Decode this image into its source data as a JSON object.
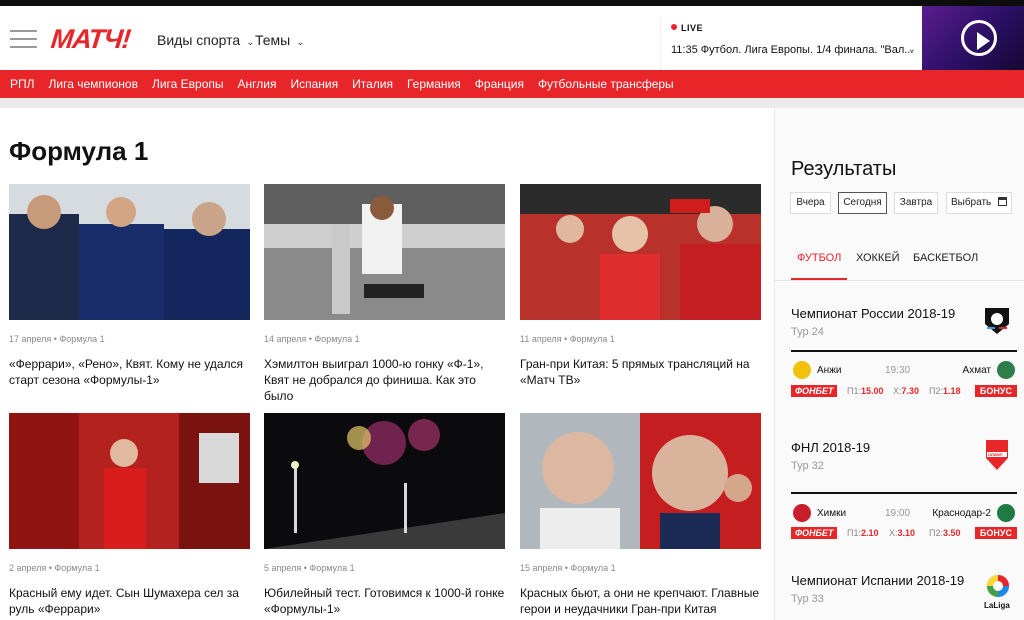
{
  "header": {
    "logo": "МАТЧ!",
    "nav": [
      {
        "label": "Виды спорта"
      },
      {
        "label": "Темы"
      }
    ],
    "live_label": "LIVE",
    "live_text": "11:35 Футбол. Лига Европы. 1/4 финала. \"Вал..."
  },
  "subnav": [
    "РПЛ",
    "Лига чемпионов",
    "Лига Европы",
    "Англия",
    "Испания",
    "Италия",
    "Германия",
    "Франция",
    "Футбольные трансферы"
  ],
  "page": {
    "title": "Формула 1"
  },
  "cards": [
    {
      "date": "17 апреля",
      "tag": "Формула 1",
      "title": "«Феррари», «Рено», Квят. Кому не удался старт сезона «Формулы-1»"
    },
    {
      "date": "14 апреля",
      "tag": "Формула 1",
      "title": "Хэмилтон выиграл 1000-ю гонку «Ф-1», Квят не добрался до финиша. Как это было"
    },
    {
      "date": "11 апреля",
      "tag": "Формула 1",
      "title": "Гран-при Китая: 5 прямых трансляций на «Матч ТВ»"
    },
    {
      "date": "2 апреля",
      "tag": "Формула 1",
      "title": "Красный ему идет. Сын Шумахера сел за руль «Феррари»"
    },
    {
      "date": "5 апреля",
      "tag": "Формула 1",
      "title": "Юбилейный тест. Готовимся к 1000-й гонке «Формулы-1»"
    },
    {
      "date": "15 апреля",
      "tag": "Формула 1",
      "title": "Красных бьют, а они не крепчают. Главные герои и неудачники Гран-при Китая"
    }
  ],
  "sidebar": {
    "title": "Результаты",
    "days": [
      "Вчера",
      "Сегодня",
      "Завтра",
      "Выбрать"
    ],
    "sports": [
      "ФУТБОЛ",
      "ХОККЕЙ",
      "БАСКЕТБОЛ"
    ],
    "leagues": [
      {
        "name": "Чемпионат России 2018-19",
        "round": "Тур 24",
        "match": {
          "home": "Анжи",
          "time": "19:30",
          "away": "Ахмат",
          "bookmaker": "ФОНБЕТ",
          "p1_label": "П1:",
          "p1": "15.00",
          "x_label": "Х:",
          "x": "7.30",
          "p2_label": "П2:",
          "p2": "1.18",
          "bonus": "БОНУС"
        }
      },
      {
        "name": "ФНЛ 2018-19",
        "round": "Тур 32",
        "match": {
          "home": "Химки",
          "time": "19:00",
          "away": "Краснодар-2",
          "bookmaker": "ФОНБЕТ",
          "p1_label": "П1:",
          "p1": "2.10",
          "x_label": "Х:",
          "x": "3.10",
          "p2_label": "П2:",
          "p2": "3.50",
          "bonus": "БОНУС"
        }
      },
      {
        "name": "Чемпионат Испании 2018-19",
        "round": "Тур 33",
        "logo_text": "LaLiga"
      }
    ],
    "fnl_logo_text": "ОЛИМП"
  }
}
